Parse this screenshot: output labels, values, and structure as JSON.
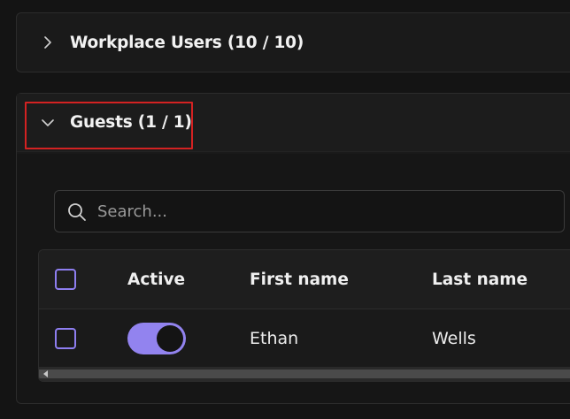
{
  "panels": {
    "workplace": {
      "title": "Workplace Users (10 / 10)",
      "expanded": false
    },
    "guests": {
      "title": "Guests (1 / 1)",
      "expanded": true
    }
  },
  "search": {
    "placeholder": "Search..."
  },
  "table": {
    "columns": [
      "",
      "Active",
      "First name",
      "Last name"
    ],
    "rows": [
      {
        "selected": false,
        "active": true,
        "first_name": "Ethan",
        "last_name": "Wells"
      }
    ]
  },
  "colors": {
    "accent": "#9283ef",
    "highlight": "#d32222"
  }
}
